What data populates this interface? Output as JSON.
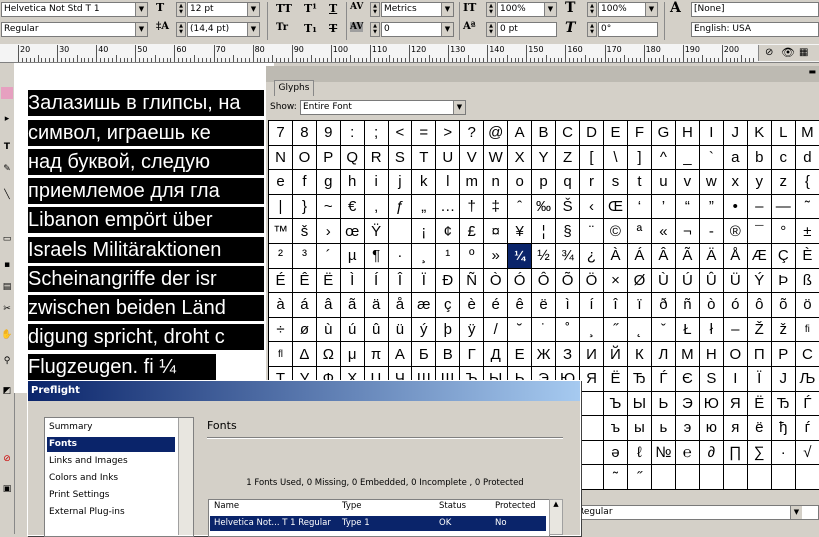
{
  "control_bar": {
    "font_family": "Helvetica Not Std T 1",
    "font_style": "Regular",
    "font_size": "12 pt",
    "leading": "(14,4 pt)",
    "kerning": "Metrics",
    "tracking": "0",
    "vertical_scale": "100%",
    "baseline_shift": "0 pt",
    "horizontal_scale": "100%",
    "skew": "0°",
    "char_style": "[None]",
    "language": "English: USA",
    "type_buttons_row1": [
      "TT",
      "T¹",
      "T"
    ],
    "type_buttons_row2": [
      "Tr",
      "T₁",
      "T"
    ]
  },
  "ruler": {
    "labels": [
      "20",
      "30",
      "40",
      "50",
      "60",
      "70",
      "80",
      "90",
      "100",
      "110",
      "120",
      "130",
      "140",
      "150",
      "160",
      "170",
      "180",
      "190",
      "200",
      "210",
      "220",
      "230"
    ]
  },
  "document": {
    "lines": [
      "Залазишь в глипсы, на",
      "символ, играешь ке",
      "над буквой, следую",
      "приемлемое для гла",
      "Libanon empört über",
      "Israels Militäraktionen",
      "Scheinangriffe der isr",
      "zwischen beiden Länd",
      "digung spricht, droht c",
      "Flugzeugen. fi ¼"
    ]
  },
  "glyphs_panel": {
    "tab_label": "Glyphs",
    "show_label": "Show:",
    "show_value": "Entire Font",
    "font_style_value": "Regular",
    "rows": [
      [
        "7",
        "8",
        "9",
        ":",
        ";",
        "<",
        "=",
        ">",
        "?",
        "@",
        "A",
        "B",
        "C",
        "D",
        "E",
        "F",
        "G",
        "H",
        "I",
        "J",
        "K",
        "L",
        "M"
      ],
      [
        "N",
        "O",
        "P",
        "Q",
        "R",
        "S",
        "T",
        "U",
        "V",
        "W",
        "X",
        "Y",
        "Z",
        "[",
        "\\",
        "]",
        "^",
        "_",
        "`",
        "a",
        "b",
        "c",
        "d"
      ],
      [
        "e",
        "f",
        "g",
        "h",
        "i",
        "j",
        "k",
        "l",
        "m",
        "n",
        "o",
        "p",
        "q",
        "r",
        "s",
        "t",
        "u",
        "v",
        "w",
        "x",
        "y",
        "z",
        "{"
      ],
      [
        "|",
        "}",
        "~",
        "€",
        "‚",
        "ƒ",
        "„",
        "…",
        "†",
        "‡",
        "ˆ",
        "‰",
        "Š",
        "‹",
        "Œ",
        "‘",
        "’",
        "“",
        "”",
        "•",
        "–",
        "—",
        "˜"
      ],
      [
        "™",
        "š",
        "›",
        "œ",
        "Ÿ",
        " ",
        "¡",
        "¢",
        "£",
        "¤",
        "¥",
        "¦",
        "§",
        "¨",
        "©",
        "ª",
        "«",
        "¬",
        "-",
        "®",
        "¯",
        "°",
        "±"
      ],
      [
        "²",
        "³",
        "´",
        "µ",
        "¶",
        "·",
        "¸",
        "¹",
        "º",
        "»",
        "¼",
        "½",
        "¾",
        "¿",
        "À",
        "Á",
        "Â",
        "Ã",
        "Ä",
        "Å",
        "Æ",
        "Ç",
        "È"
      ],
      [
        "É",
        "Ê",
        "Ë",
        "Ì",
        "Í",
        "Î",
        "Ï",
        "Ð",
        "Ñ",
        "Ò",
        "Ó",
        "Ô",
        "Õ",
        "Ö",
        "×",
        "Ø",
        "Ù",
        "Ú",
        "Û",
        "Ü",
        "Ý",
        "Þ",
        "ß"
      ],
      [
        "à",
        "á",
        "â",
        "ã",
        "ä",
        "å",
        "æ",
        "ç",
        "è",
        "é",
        "ê",
        "ë",
        "ì",
        "í",
        "î",
        "ï",
        "ð",
        "ñ",
        "ò",
        "ó",
        "ô",
        "õ",
        "ö"
      ],
      [
        "÷",
        "ø",
        "ù",
        "ú",
        "û",
        "ü",
        "ý",
        "þ",
        "ÿ",
        "/",
        "˘",
        "˙",
        "˚",
        "¸",
        "˝",
        "˛",
        "ˇ",
        "Ł",
        "ł",
        "–",
        "Ž",
        "ž",
        "fi"
      ],
      [
        "fl",
        "Δ",
        "Ω",
        "μ",
        "π",
        "А",
        "Б",
        "В",
        "Г",
        "Д",
        "Е",
        "Ж",
        "З",
        "И",
        "Й",
        "К",
        "Л",
        "М",
        "Н",
        "О",
        "П",
        "Р",
        "С"
      ],
      [
        "Т",
        "У",
        "Ф",
        "Х",
        "Ц",
        "Ч",
        "Ш",
        "Щ",
        "Ъ",
        "Ы",
        "Ь",
        "Э",
        "Ю",
        "Я",
        "Ё",
        "Ђ",
        "Ѓ",
        "Є",
        "Ѕ",
        "І",
        "Ї",
        "Ј",
        "Љ"
      ],
      [
        "",
        "",
        "",
        "",
        "",
        "",
        "",
        "",
        "",
        "",
        "",
        "",
        "",
        "",
        "Ъ",
        "Ы",
        "Ь",
        "Э",
        "Ю",
        "Я",
        "Ё",
        "Ђ",
        "Ѓ"
      ],
      [
        "",
        "",
        "",
        "",
        "",
        "",
        "",
        "",
        "",
        "",
        "",
        "",
        "",
        "",
        "ъ",
        "ы",
        "ь",
        "э",
        "ю",
        "я",
        "ё",
        "ђ",
        "ѓ"
      ],
      [
        "",
        "",
        "",
        "",
        "",
        "",
        "",
        "",
        "",
        "",
        "",
        "",
        "",
        "",
        "ә",
        "ℓ",
        "№",
        "℮",
        "∂",
        "∏",
        "∑",
        "·",
        "√"
      ],
      [
        "",
        "",
        "",
        "",
        "",
        "",
        "",
        "",
        "",
        "",
        "",
        "",
        "",
        "",
        "˜",
        "˝",
        "",
        "",
        "",
        "",
        "",
        "",
        ""
      ]
    ],
    "selected": "¼"
  },
  "preflight": {
    "title": "Preflight",
    "nav": [
      "Summary",
      "Fonts",
      "Links and Images",
      "Colors and Inks",
      "Print Settings",
      "External Plug-ins"
    ],
    "active_nav": "Fonts",
    "section_heading": "Fonts",
    "summary_text": "1 Fonts Used, 0 Missing, 0 Embedded, 0 Incomplete , 0 Protected",
    "columns": [
      "Name",
      "Type",
      "Status",
      "Protected"
    ],
    "rows": [
      {
        "name": "Helvetica Not... T 1 Regular",
        "type": "Type 1",
        "status": "OK",
        "protected": "No"
      }
    ]
  }
}
